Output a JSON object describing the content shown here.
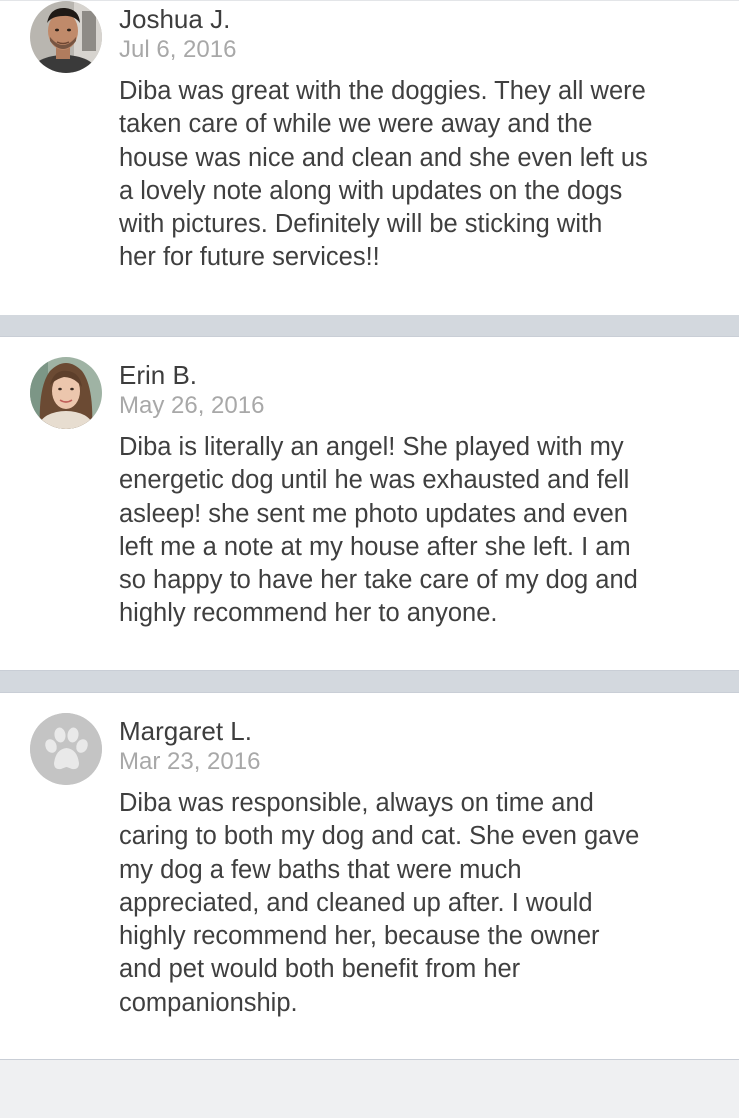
{
  "reviews": [
    {
      "name": "Joshua J.",
      "date": "Jul 6, 2016",
      "avatar_icon": "user-photo-joshua",
      "text": "Diba was great with the doggies. They all were\ntaken care of while we were away and the\nhouse was nice and clean and she even left us\na lovely note along with updates on the dogs\nwith pictures. Definitely will be sticking with\nher for future services!!"
    },
    {
      "name": "Erin B.",
      "date": "May 26, 2016",
      "avatar_icon": "user-photo-erin",
      "text": "Diba is literally an angel! She played with my\nenergetic dog until he was exhausted and fell\nasleep! she sent me photo updates and even\nleft me a note at my house after she left. I am\nso happy to have her take care of my dog and\nhighly recommend her to anyone."
    },
    {
      "name": "Margaret L.",
      "date": "Mar 23, 2016",
      "avatar_icon": "paw-placeholder-icon",
      "text": "Diba was responsible, always on time and\ncaring to both my dog and cat.  She even gave\nmy dog a few baths that were much\nappreciated, and cleaned up after.  I would\nhighly recommend her, because the owner\nand pet would both benefit from her\ncompanionship."
    }
  ],
  "colors": {
    "accent": "#2bb673",
    "separator": "#d3d8de",
    "name_text": "#3d3d3d",
    "date_text": "#a8a8a8",
    "body_text": "#3f3f3f",
    "placeholder_avatar": "#c4c4c4"
  }
}
